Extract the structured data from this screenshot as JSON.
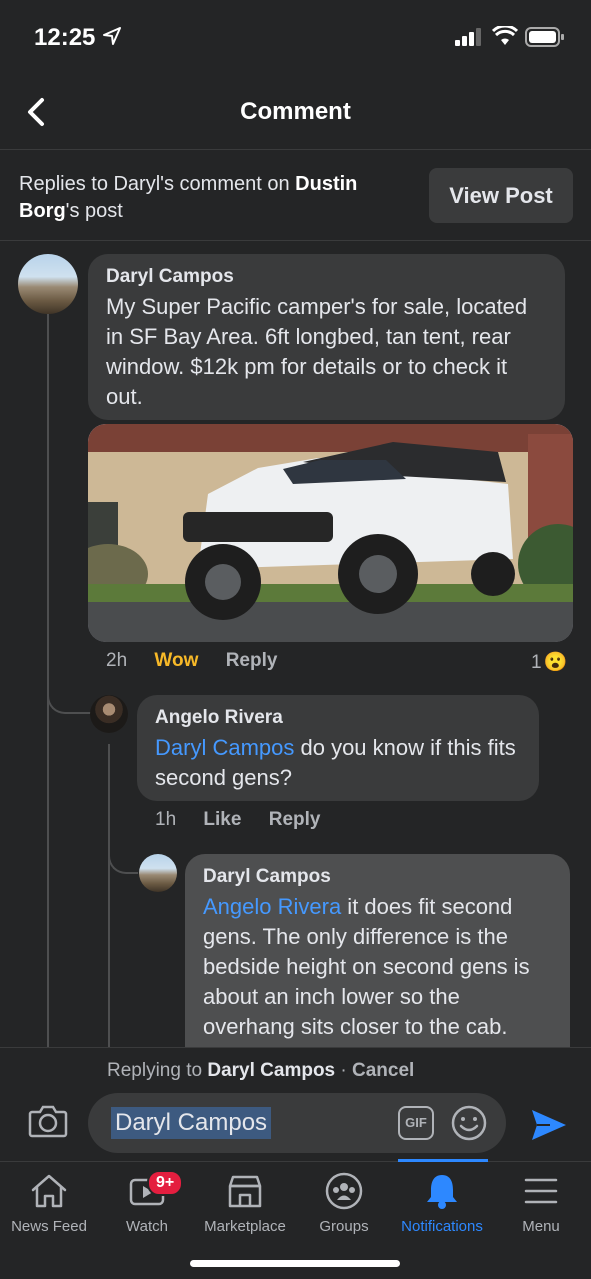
{
  "status_bar": {
    "time": "12:25"
  },
  "header": {
    "title": "Comment"
  },
  "context": {
    "prefix": "Replies to Daryl's comment on ",
    "post_author_first": "Dustin",
    "post_author_last": "Borg",
    "suffix": "'s post",
    "view_post_label": "View Post"
  },
  "comments": [
    {
      "author": "Daryl Campos",
      "text": "My Super Pacific camper's for sale, located in SF Bay Area. 6ft longbed, tan tent, rear window. $12k pm for details or to check it out.",
      "time": "2h",
      "reaction_label": "Wow",
      "reply_label": "Reply",
      "reaction_count": "1",
      "reaction_emoji": "😮"
    },
    {
      "author": "Angelo Rivera",
      "mention": "Daryl Campos",
      "text": " do you know if this fits second gens?",
      "time": "1h",
      "like_label": "Like",
      "reply_label": "Reply"
    },
    {
      "author": "Daryl Campos",
      "mention": "Angelo Rivera",
      "text": " it does fit second gens. The only difference is the bedside height on second gens is about an inch lower so the overhang sits closer to the cab."
    }
  ],
  "reply_bar": {
    "replying_prefix": "Replying to ",
    "replying_to": "Daryl Campos",
    "separator": " · ",
    "cancel_label": "Cancel",
    "input_value": "Daryl Campos",
    "gif_label": "GIF"
  },
  "tabs": [
    {
      "label": "News Feed",
      "icon": "home-icon"
    },
    {
      "label": "Watch",
      "icon": "watch-icon",
      "badge": "9+"
    },
    {
      "label": "Marketplace",
      "icon": "marketplace-icon"
    },
    {
      "label": "Groups",
      "icon": "groups-icon"
    },
    {
      "label": "Notifications",
      "icon": "bell-icon",
      "active": true
    },
    {
      "label": "Menu",
      "icon": "menu-icon"
    }
  ],
  "colors": {
    "background": "#242526",
    "bubble": "#3a3b3c",
    "accent": "#2d88ff",
    "mention": "#4599ff",
    "wow": "#f7b928",
    "badge": "#e41e3f"
  }
}
